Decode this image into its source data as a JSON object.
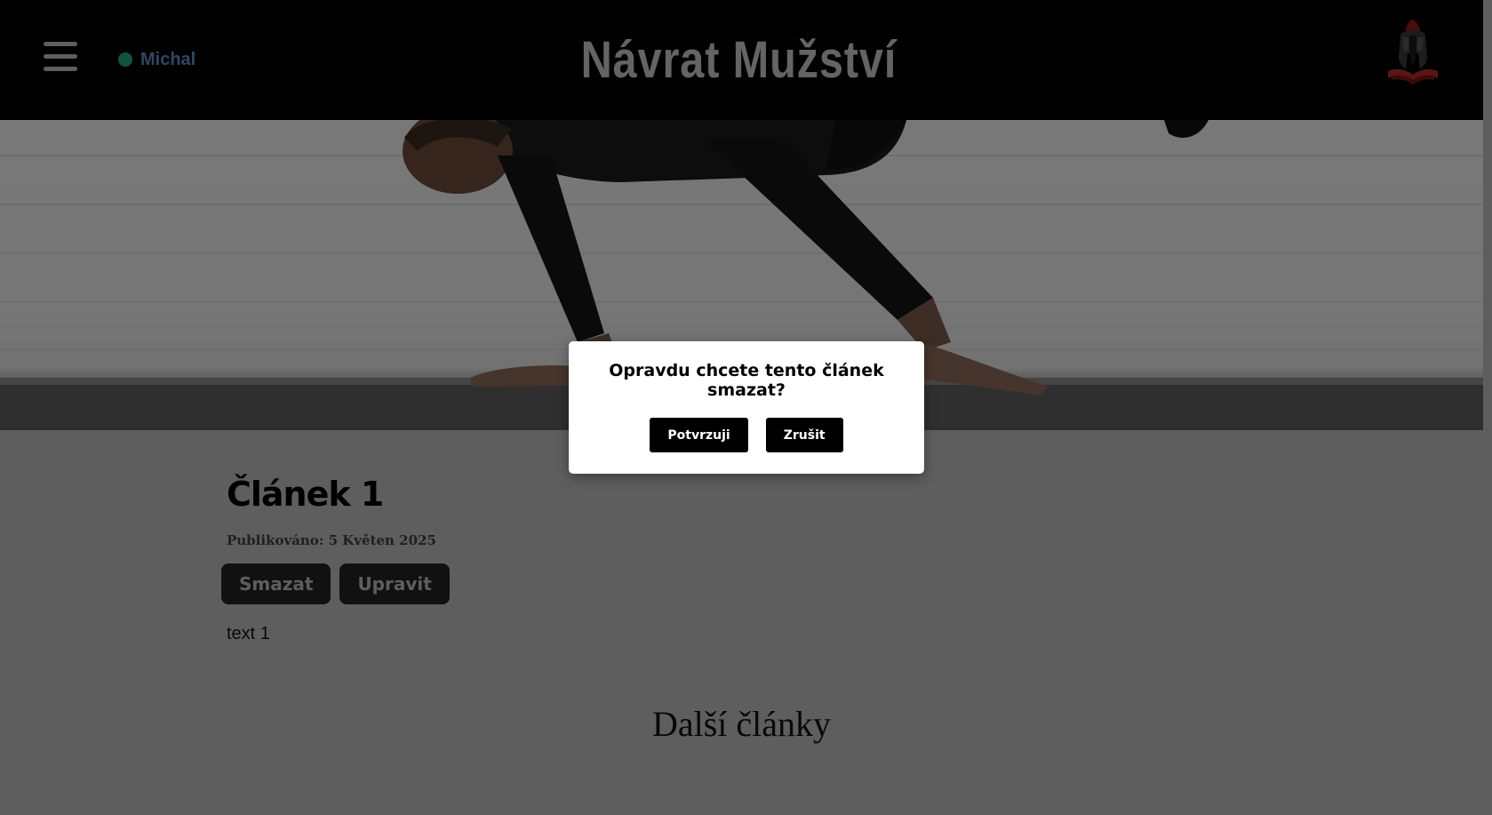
{
  "header": {
    "user_name": "Michal",
    "user_status_color": "#1fa984",
    "site_title": "Návrat Mužství",
    "menu_icon": "hamburger-menu-icon",
    "logo_icon": "spartan-helmet-logo"
  },
  "hero": {
    "image": "man-doing-push-up-on-floor-photo"
  },
  "article": {
    "title": "Článek 1",
    "published": "Publikováno: 5 Květen 2025",
    "delete_label": "Smazat",
    "edit_label": "Upravit",
    "text": "text 1"
  },
  "more": {
    "title": "Další články"
  },
  "modal": {
    "question": "Opravdu chcete tento článek smazat?",
    "confirm_label": "Potvrzuji",
    "cancel_label": "Zrušit"
  }
}
